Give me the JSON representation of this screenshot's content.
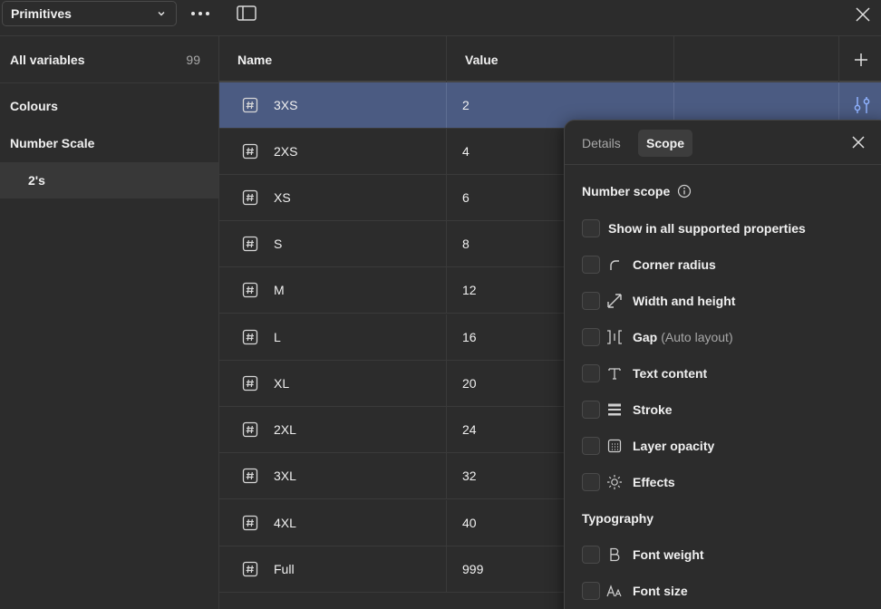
{
  "topbar": {
    "collection": "Primitives"
  },
  "sidebar": {
    "all_variables": {
      "label": "All variables",
      "count": "99"
    },
    "groups": [
      {
        "label": "Colours"
      },
      {
        "label": "Number Scale"
      },
      {
        "label": "2's"
      }
    ]
  },
  "table": {
    "headers": {
      "name": "Name",
      "value": "Value"
    },
    "rows": [
      {
        "name": "3XS",
        "value": "2"
      },
      {
        "name": "2XS",
        "value": "4"
      },
      {
        "name": "XS",
        "value": "6"
      },
      {
        "name": "S",
        "value": "8"
      },
      {
        "name": "M",
        "value": "12"
      },
      {
        "name": "L",
        "value": "16"
      },
      {
        "name": "XL",
        "value": "20"
      },
      {
        "name": "2XL",
        "value": "24"
      },
      {
        "name": "3XL",
        "value": "32"
      },
      {
        "name": "4XL",
        "value": "40"
      },
      {
        "name": "Full",
        "value": "999"
      }
    ]
  },
  "scope_panel": {
    "tabs": {
      "details": "Details",
      "scope": "Scope"
    },
    "number_scope": "Number scope",
    "options": {
      "all": "Show in all supported properties",
      "corner_radius": "Corner radius",
      "width_height": "Width and height",
      "gap": "Gap",
      "gap_suffix": "(Auto layout)",
      "text_content": "Text content",
      "stroke": "Stroke",
      "layer_opacity": "Layer opacity",
      "effects": "Effects"
    },
    "typography": "Typography",
    "typography_options": {
      "font_weight": "Font weight",
      "font_size": "Font size"
    }
  },
  "colors": {
    "background": "#2c2c2c",
    "selected_row": "#4b5b82",
    "border": "#3a3a3a"
  }
}
